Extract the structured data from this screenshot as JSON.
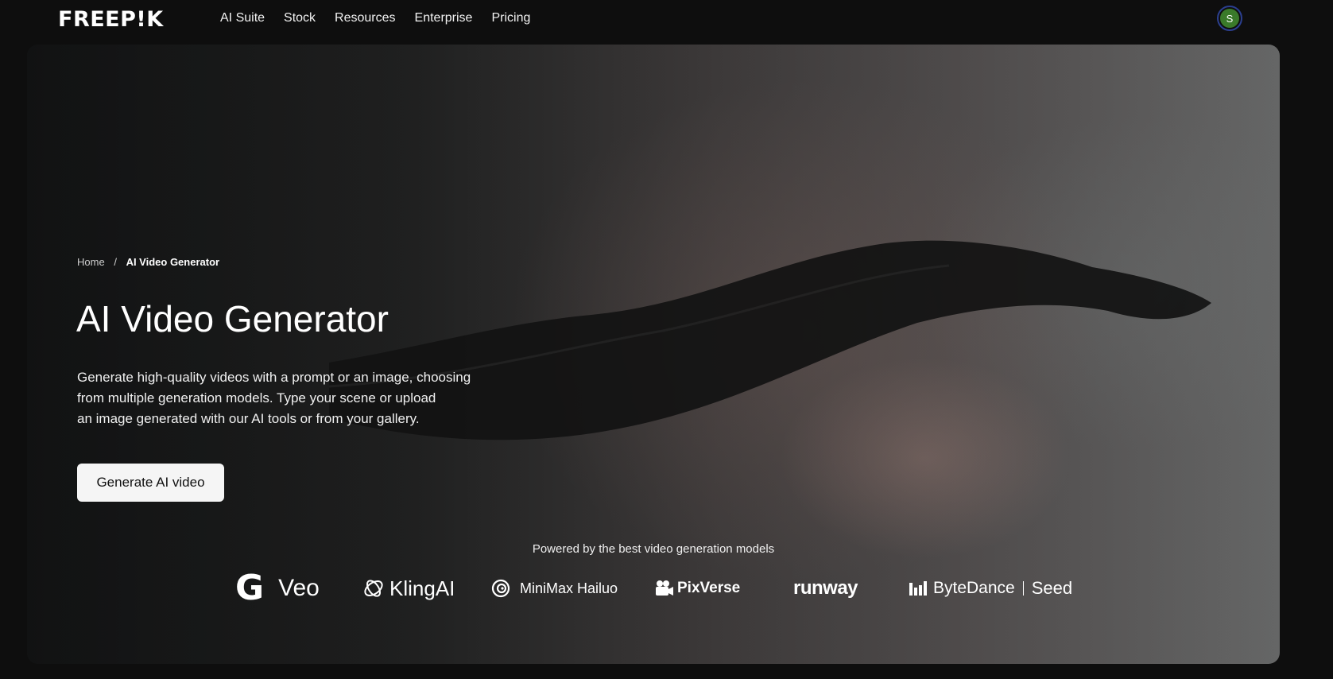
{
  "header": {
    "logo": "FREEP!K",
    "nav": [
      "AI Suite",
      "Stock",
      "Resources",
      "Enterprise",
      "Pricing"
    ],
    "avatar_initial": "S"
  },
  "hero": {
    "breadcrumb": {
      "home": "Home",
      "separator": "/",
      "current": "AI Video Generator"
    },
    "title": "AI Video Generator",
    "description_lines": [
      "Generate high-quality videos with a prompt or an image, choosing",
      "from multiple generation models. Type your scene or upload",
      "an image generated with our AI tools or from your gallery."
    ],
    "cta_label": "Generate AI video",
    "powered_by": "Powered by the best video generation models",
    "brands": {
      "veo_mark": "G",
      "veo": "Veo",
      "kling": "KlingAI",
      "minimax": "MiniMax Hailuo",
      "pixverse": "PixVerse",
      "runway": "runway",
      "bytedance": "ByteDance",
      "seed": "Seed"
    }
  },
  "colors": {
    "page_bg": "#0e0e0e",
    "cta_bg": "#f5f5f5",
    "avatar_bg": "#3a7a2a",
    "avatar_ring": "#2b3f8f"
  }
}
